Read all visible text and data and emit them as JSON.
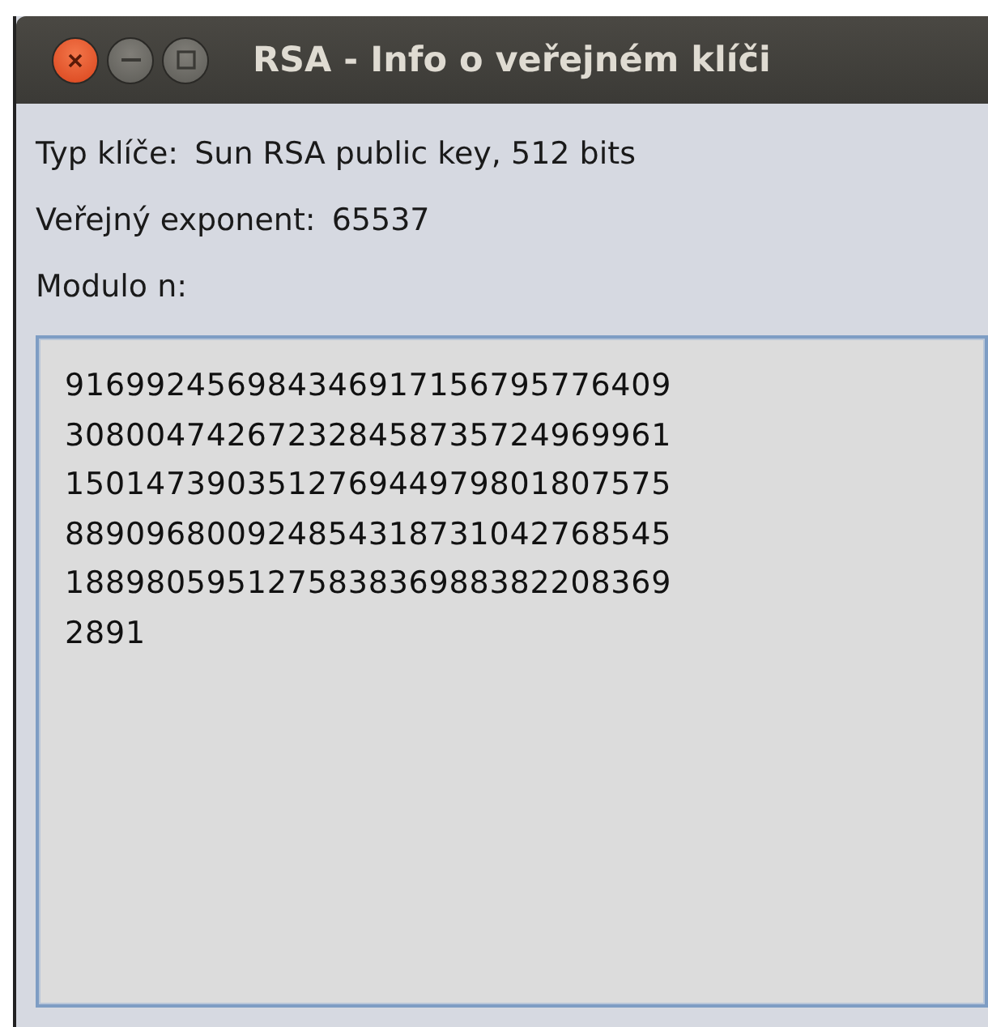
{
  "window": {
    "title": "RSA - Info o veřejném klíči"
  },
  "fields": [
    {
      "label": "Typ klíče:",
      "value": "Sun RSA public key, 512 bits"
    },
    {
      "label": "Veřejný exponent:",
      "value": "65537"
    },
    {
      "label": "Modulo n:"
    }
  ],
  "modulus": {
    "lines": [
      "916992456984346917156795776409",
      "308004742672328458735724969961",
      "150147390351276944979801807575",
      "889096800924854318731042768545",
      "188980595127583836988382208369",
      "2891"
    ]
  }
}
